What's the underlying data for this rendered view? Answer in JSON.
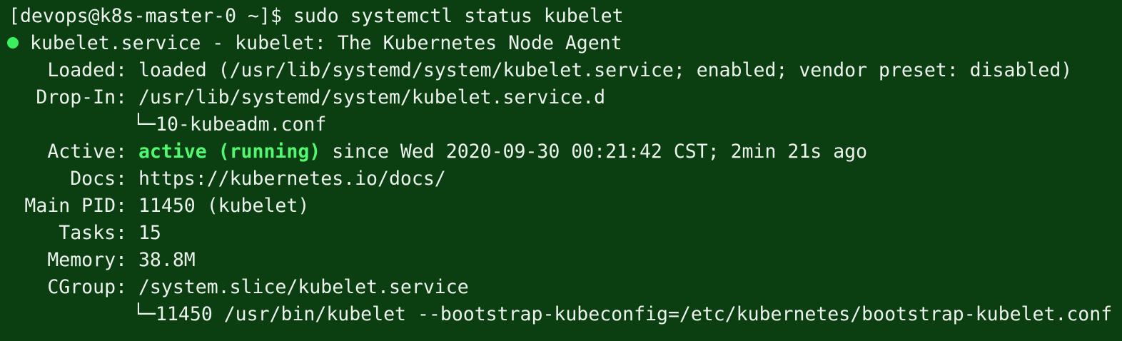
{
  "terminal": {
    "prompt": "[devops@k8s-master-0 ~]$",
    "command": "sudo systemctl status kubelet",
    "service_header": "kubelet.service - kubelet: The Kubernetes Node Agent",
    "status_dot_color": "#3bf05f",
    "active_color": "#52f871",
    "background_color": "#0b3f12",
    "fields": {
      "loaded_label": "Loaded:",
      "loaded_value": "loaded (/usr/lib/systemd/system/kubelet.service; enabled; vendor preset: disabled)",
      "dropin_label": "Drop-In:",
      "dropin_value": "/usr/lib/systemd/system/kubelet.service.d",
      "dropin_child": "10-kubeadm.conf",
      "active_label": "Active:",
      "active_state": "active (running)",
      "active_since": " since Wed 2020-09-30 00:21:42 CST; 2min 21s ago",
      "docs_label": "Docs:",
      "docs_value": "https://kubernetes.io/docs/",
      "mainpid_label": "Main PID:",
      "mainpid_value": "11450 (kubelet)",
      "tasks_label": "Tasks:",
      "tasks_value": "15",
      "memory_label": "Memory:",
      "memory_value": "38.8M",
      "cgroup_label": "CGroup:",
      "cgroup_value": "/system.slice/kubelet.service",
      "cgroup_child": "11450 /usr/bin/kubelet --bootstrap-kubeconfig=/etc/kubernetes/bootstrap-kubelet.conf"
    },
    "tree_glyph": "└─"
  }
}
